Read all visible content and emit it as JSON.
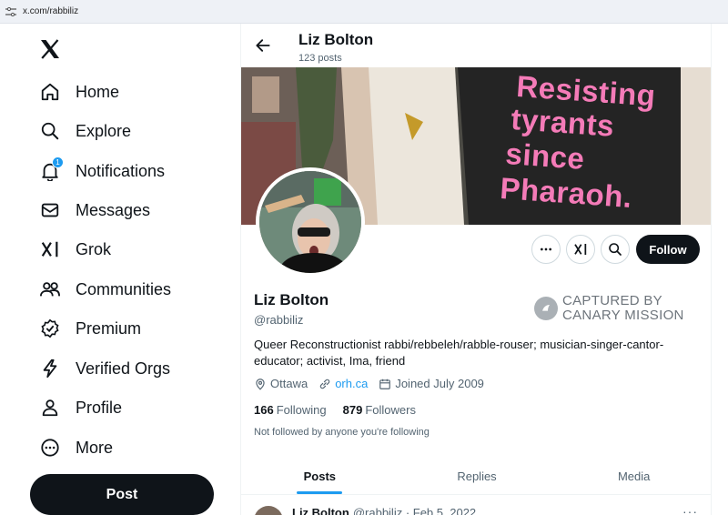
{
  "browser": {
    "url": "x.com/rabbiliz"
  },
  "sidebar": {
    "items": [
      {
        "label": "Home",
        "icon": "home-icon"
      },
      {
        "label": "Explore",
        "icon": "search-icon"
      },
      {
        "label": "Notifications",
        "icon": "bell-icon",
        "badge": "1"
      },
      {
        "label": "Messages",
        "icon": "mail-icon"
      },
      {
        "label": "Grok",
        "icon": "grok-icon"
      },
      {
        "label": "Communities",
        "icon": "people-icon"
      },
      {
        "label": "Premium",
        "icon": "verified-badge-icon"
      },
      {
        "label": "Verified Orgs",
        "icon": "lightning-icon"
      },
      {
        "label": "Profile",
        "icon": "person-icon"
      },
      {
        "label": "More",
        "icon": "more-circle-icon"
      }
    ],
    "post_label": "Post"
  },
  "header": {
    "name": "Liz Bolton",
    "post_count": "123 posts"
  },
  "banner": {
    "sign_lines": [
      "Resisting",
      "tyrants",
      "since",
      "Pharaoh."
    ]
  },
  "profile": {
    "name": "Liz Bolton",
    "handle": "@rabbiliz",
    "follow_label": "Follow",
    "bio": "Queer Reconstructionist rabbi/rebbeleh/rabble-rouser; musician-singer-cantor-educator; activist, Ima, friend",
    "location": "Ottawa",
    "website": "orh.ca",
    "joined": "Joined July 2009",
    "following_count": "166",
    "following_label": "Following",
    "followers_count": "879",
    "followers_label": "Followers",
    "not_followed": "Not followed by anyone you're following"
  },
  "watermark": {
    "line1": "CAPTURED BY",
    "line2": "CANARY MISSION"
  },
  "tabs": [
    {
      "label": "Posts",
      "active": true
    },
    {
      "label": "Replies",
      "active": false
    },
    {
      "label": "Media",
      "active": false
    }
  ],
  "peek_post": {
    "name": "Liz Bolton",
    "meta": "@rabbiliz · Feb 5, 2022"
  },
  "colors": {
    "accent": "#1d9bf0",
    "text": "#0f1419",
    "muted": "#536471",
    "sign_pink": "#f47bb8"
  }
}
